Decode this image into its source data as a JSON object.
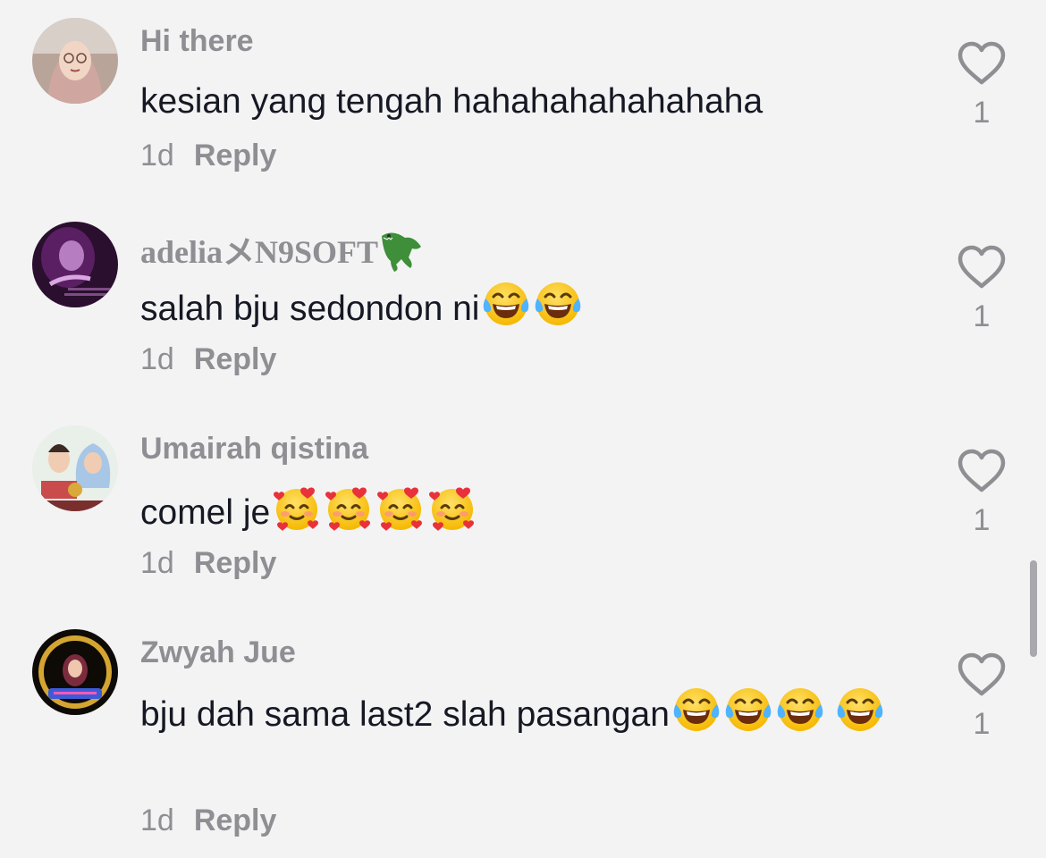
{
  "colors": {
    "background": "#f3f3f4",
    "username": "#8e8e93",
    "text": "#161823",
    "meta": "#8e8e93"
  },
  "comments": [
    {
      "username": "Hi there",
      "text": "kesian yang tengah hahahahahahahaha",
      "emojis": [],
      "age": "1d",
      "reply_label": "Reply",
      "likes": "1"
    },
    {
      "username": "adeliaメN9SOFT",
      "username_icon": "crocodile-emoji",
      "text": "salah bju sedondon ni",
      "emojis": [
        "tears-of-joy-emoji",
        "tears-of-joy-emoji"
      ],
      "age": "1d",
      "reply_label": "Reply",
      "likes": "1"
    },
    {
      "username": "Umairah qistina",
      "text": "comel je",
      "emojis": [
        "smiling-face-with-hearts-emoji",
        "smiling-face-with-hearts-emoji",
        "smiling-face-with-hearts-emoji",
        "smiling-face-with-hearts-emoji"
      ],
      "age": "1d",
      "reply_label": "Reply",
      "likes": "1"
    },
    {
      "username": "Zwyah Jue",
      "text": "bju dah sama last2 slah pasangan",
      "emojis": [
        "tears-of-joy-emoji",
        "tears-of-joy-emoji",
        "tears-of-joy-emoji",
        "tears-of-joy-emoji"
      ],
      "age": "1d",
      "reply_label": "Reply",
      "likes": "1"
    }
  ],
  "icons": {
    "like": "heart-outline-icon"
  }
}
